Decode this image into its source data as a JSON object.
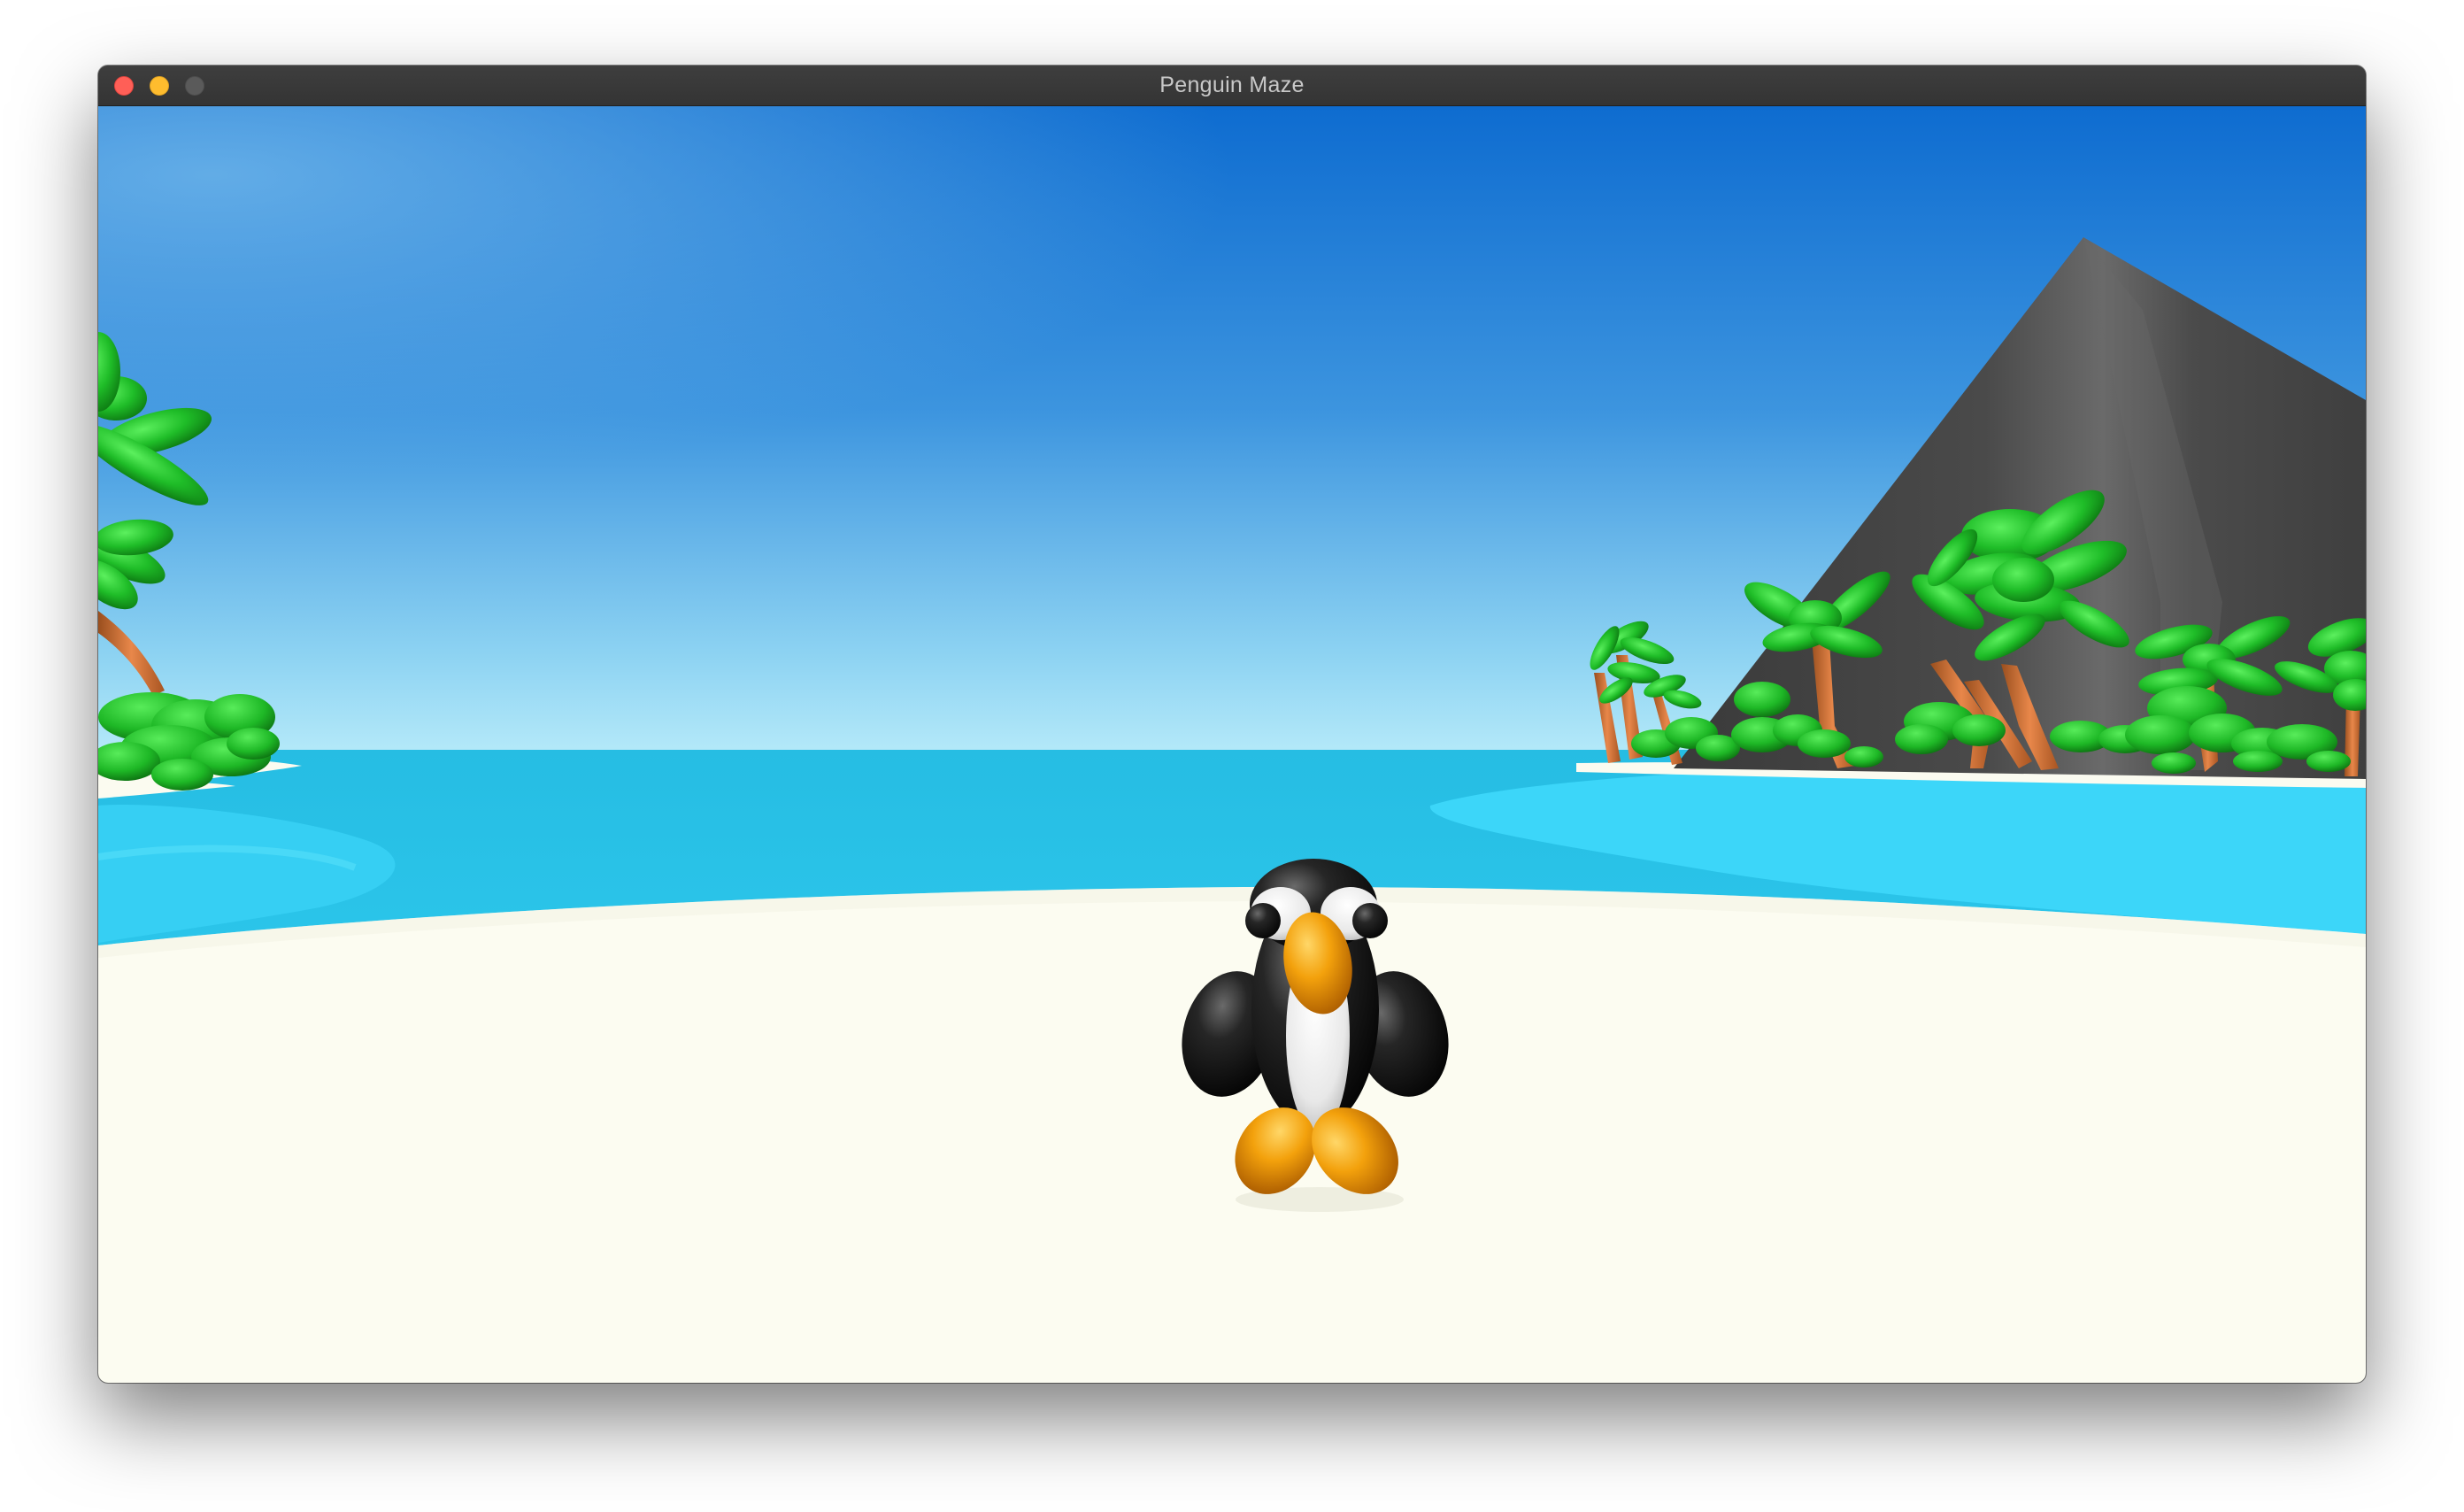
{
  "window": {
    "title": "Penguin Maze",
    "controls": {
      "close": "close-button",
      "minimize": "minimize-button",
      "zoom": "zoom-button"
    }
  },
  "scene": {
    "description_icons": [
      "sky",
      "sea",
      "beach",
      "volcano-mountain",
      "palm-tree",
      "bush",
      "penguin"
    ],
    "colors": {
      "sky_top": "#0e6fd2",
      "sky_horizon": "#bff0fb",
      "sea": "#29c2e6",
      "sea_light": "#40d8fa",
      "sand": "#fcfcf1",
      "mountain": "#505050",
      "palm_leaf": "#22c22e",
      "palm_trunk": "#c8682c",
      "penguin_body": "#111111",
      "penguin_belly": "#e6e6e6",
      "penguin_beak_feet": "#f2a20c"
    }
  }
}
